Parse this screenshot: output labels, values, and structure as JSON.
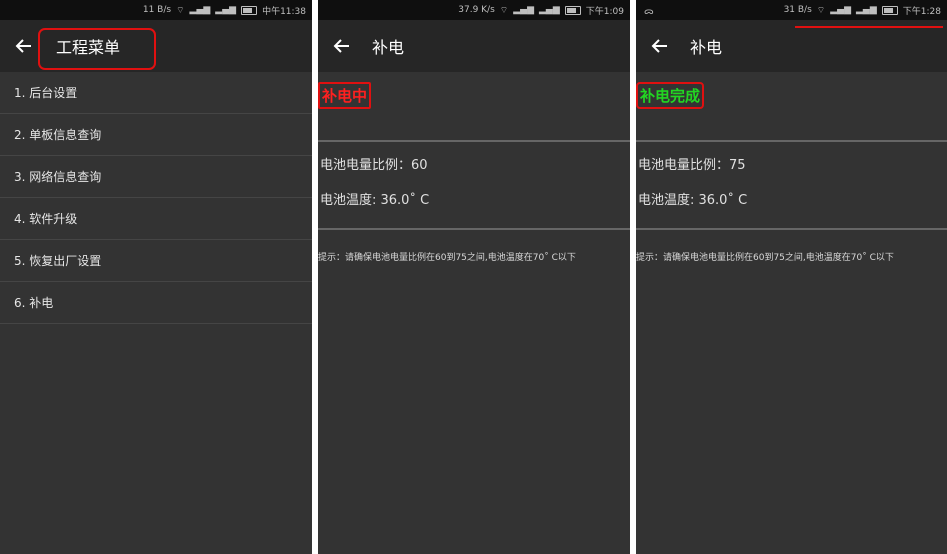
{
  "colors": {
    "background": "#333333",
    "statusbar": "#0f0f0f",
    "appbar": "#262626",
    "annotation_red": "#e01010",
    "charging_red": "#ff2020",
    "complete_green": "#22d622"
  },
  "screen1": {
    "status": {
      "speed": "11 B/s",
      "time": "中午11:38"
    },
    "title": "工程菜单",
    "menu": [
      {
        "label": "1. 后台设置"
      },
      {
        "label": "2. 单板信息查询"
      },
      {
        "label": "3. 网络信息查询"
      },
      {
        "label": "4. 软件升级"
      },
      {
        "label": "5. 恢复出厂设置"
      },
      {
        "label": "6. 补电"
      }
    ]
  },
  "screen2": {
    "status": {
      "speed": "37.9 K/s",
      "time": "下午1:09"
    },
    "title": "补电",
    "state": "补电中",
    "battery_ratio": "电池电量比例：60",
    "battery_temp": "电池温度: 36.0˚ C",
    "hint": "提示：请确保电池电量比例在60到75之间,电池温度在70˚ C以下"
  },
  "screen3": {
    "status": {
      "left": "ᯅ",
      "speed": "31 B/s",
      "time": "下午1:28"
    },
    "title": "补电",
    "state": "补电完成",
    "battery_ratio": "电池电量比例：75",
    "battery_temp": "电池温度: 36.0˚ C",
    "hint": "提示：请确保电池电量比例在60到75之间,电池温度在70˚ C以下"
  }
}
